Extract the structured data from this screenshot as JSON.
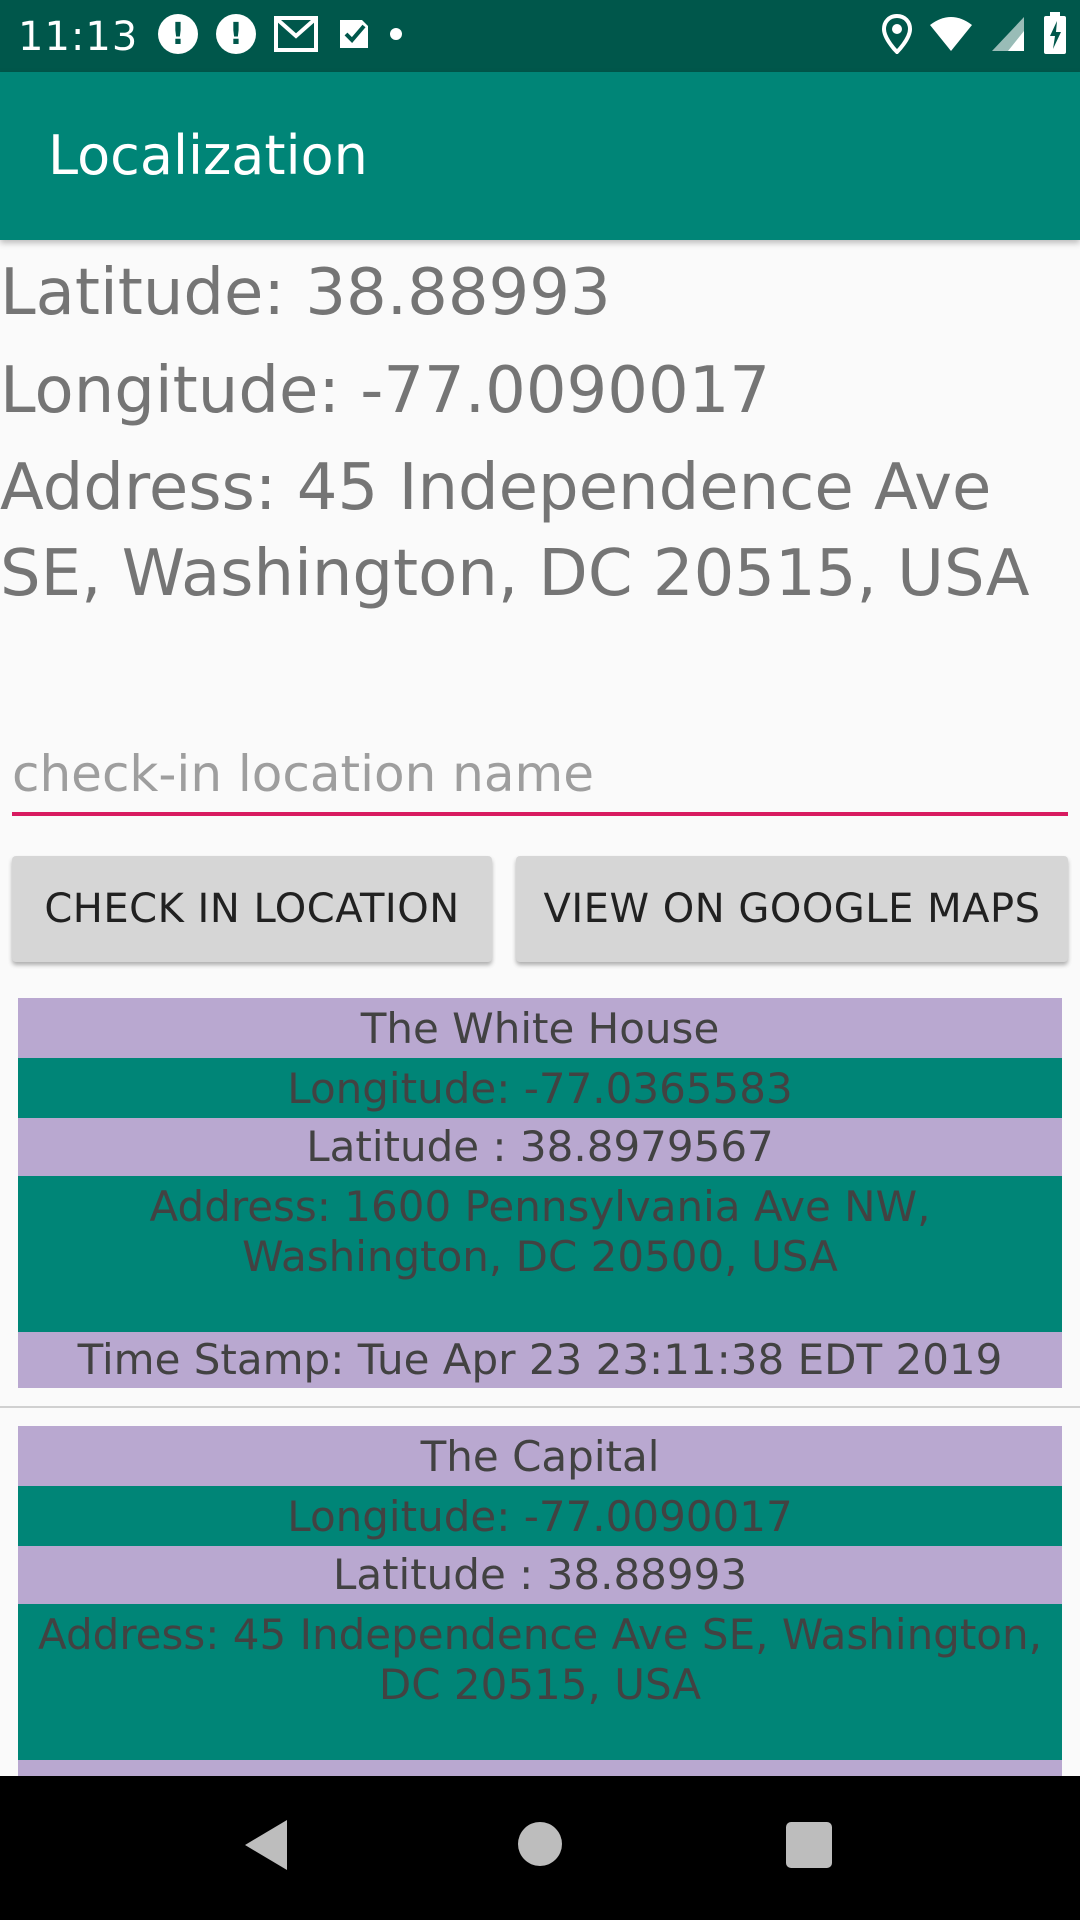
{
  "status_bar": {
    "time": "11:13",
    "left_icons": [
      "alert-icon",
      "alert-icon",
      "gmail-icon",
      "task-icon",
      "dot-icon"
    ],
    "right_icons": [
      "location-icon",
      "wifi-icon",
      "signal-icon",
      "battery-charging-icon"
    ]
  },
  "app_bar": {
    "title": "Localization"
  },
  "current": {
    "latitude": "Latitude: 38.88993",
    "longitude": "Longitude: -77.0090017",
    "address": "Address: 45 Independence Ave SE, Washington, DC 20515, USA"
  },
  "input": {
    "placeholder": "check-in location name",
    "value": ""
  },
  "buttons": {
    "check_in": "CHECK IN LOCATION",
    "view_maps": "VIEW ON GOOGLE MAPS"
  },
  "locations": [
    {
      "name": "The White House",
      "longitude": "Longitude: -77.0365583",
      "latitude": "Latitude  : 38.8979567",
      "address": "Address: 1600 Pennsylvania Ave NW, Washington, DC 20500, USA",
      "timestamp": "Time Stamp: Tue Apr 23 23:11:38 EDT 2019"
    },
    {
      "name": "The Capital",
      "longitude": "Longitude: -77.0090017",
      "latitude": "Latitude  : 38.88993",
      "address": "Address: 45 Independence Ave SE, Washington, DC 20515, USA",
      "timestamp": ""
    }
  ],
  "colors": {
    "status_bar": "#00574b",
    "app_bar": "#008577",
    "accent": "#d81b60",
    "row_purple": "#b9a8d0",
    "row_teal": "#008577"
  }
}
